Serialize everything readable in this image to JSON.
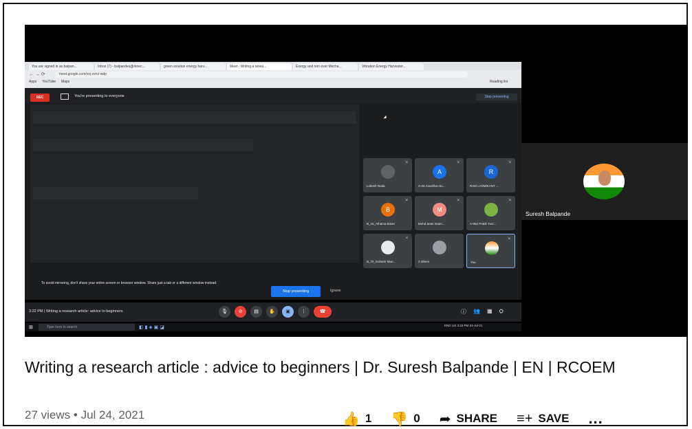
{
  "browser": {
    "tabs": [
      "You are signed in as balpan...",
      "Inbox (7) - balpandes@rknec...",
      "green solution energy harv...",
      "Meet - Writing a resea...",
      "Exergy and non exer Mecha...",
      "Vibration Energy Harvester..."
    ],
    "url": "meet.google.com/xnj-zvnz-wdp",
    "bookmarks": [
      "Apps",
      "YouTube",
      "Maps"
    ],
    "reading_list": "Reading list"
  },
  "meet": {
    "rec_label": "REC",
    "presenting_text": "You're presenting to everyone",
    "stop_top": "Stop presenting",
    "participants": [
      {
        "name": "Lokesh Noda",
        "initial": "",
        "color": "#5f6368"
      },
      {
        "name": "A-04 Anushka Atu...",
        "initial": "A",
        "color": "#1a73e8"
      },
      {
        "name": "RAM LAXMIKANT ...",
        "initial": "R",
        "color": "#1967d2"
      },
      {
        "name": "B_16_Atharva Bisan",
        "initial": "B",
        "color": "#e8710a"
      },
      {
        "name": "Mohd anas Imam...",
        "initial": "M",
        "color": "#f28b82"
      },
      {
        "name": "A-062 Pratik Yuvr...",
        "initial": "",
        "color": "#7cb342"
      },
      {
        "name": "B_70_Sohanir Mun...",
        "initial": "",
        "color": "#e8eaed"
      },
      {
        "name": "3 others",
        "initial": "",
        "color": "#9aa0a6"
      },
      {
        "name": "You",
        "initial": "",
        "color": "#ff9933"
      }
    ],
    "mirror_warning": "To avoid mirroring, don't share your entire screen or browser window. Share just a tab or a different window instead.",
    "stop_button": "Stop presenting",
    "ignore": "Ignore",
    "time_title": "3:22 PM  |  Writing a research article: advice to beginners",
    "taskbar_search": "Type here to search",
    "tray_lang": "ENG US",
    "tray_time": "3:22 PM",
    "tray_date": "24-Jul-21"
  },
  "side_participant": {
    "name": "Suresh Balpande"
  },
  "video": {
    "title": "Writing a research article : advice to beginners | Dr. Suresh Balpande | EN | RCOEM",
    "views": "27 views",
    "date": "Jul 24, 2021",
    "separator": "•",
    "likes": "1",
    "dislikes": "0",
    "share_label": "SHARE",
    "save_label": "SAVE",
    "more": "..."
  }
}
